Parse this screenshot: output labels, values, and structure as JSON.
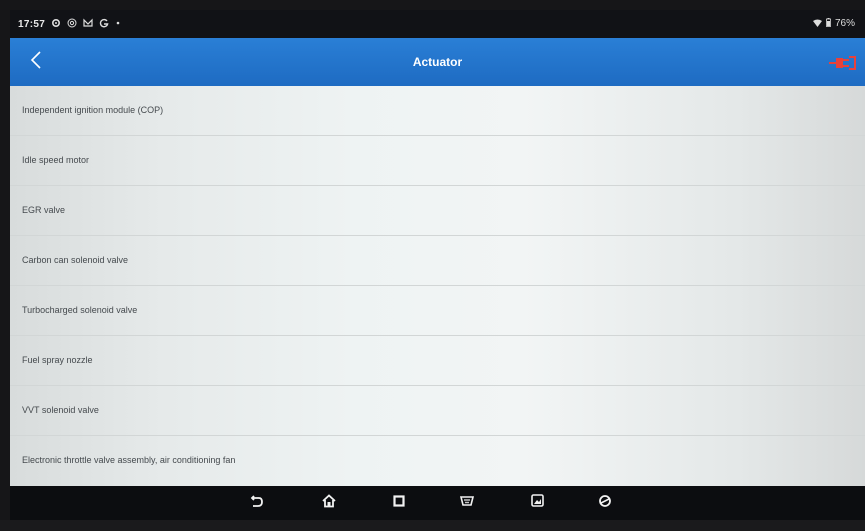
{
  "status_bar": {
    "time": "17:57",
    "icons": [
      "settings-icon",
      "at-sign-icon",
      "mail-icon",
      "google-g-icon",
      "dot-icon"
    ],
    "battery": "76%",
    "wifi_icon": "wifi-icon",
    "battery_icon": "battery-icon"
  },
  "app_bar": {
    "title": "Actuator",
    "back_icon": "back-chevron-icon",
    "connection_icon": "vci-connected-icon",
    "connection_color": "#e8413a",
    "bar_color": "#2379cf"
  },
  "list": {
    "items": [
      {
        "label": "Independent ignition module (COP)"
      },
      {
        "label": "Idle speed motor"
      },
      {
        "label": "EGR valve"
      },
      {
        "label": "Carbon can solenoid valve"
      },
      {
        "label": "Turbocharged solenoid valve"
      },
      {
        "label": "Fuel spray nozzle"
      },
      {
        "label": "VVT solenoid valve"
      },
      {
        "label": "Electronic throttle valve assembly, air conditioning fan"
      }
    ]
  },
  "nav_bar": {
    "buttons": [
      "back-icon",
      "home-icon",
      "recent-apps-icon",
      "vci-icon",
      "screenshot-icon",
      "diagnostics-icon"
    ]
  }
}
